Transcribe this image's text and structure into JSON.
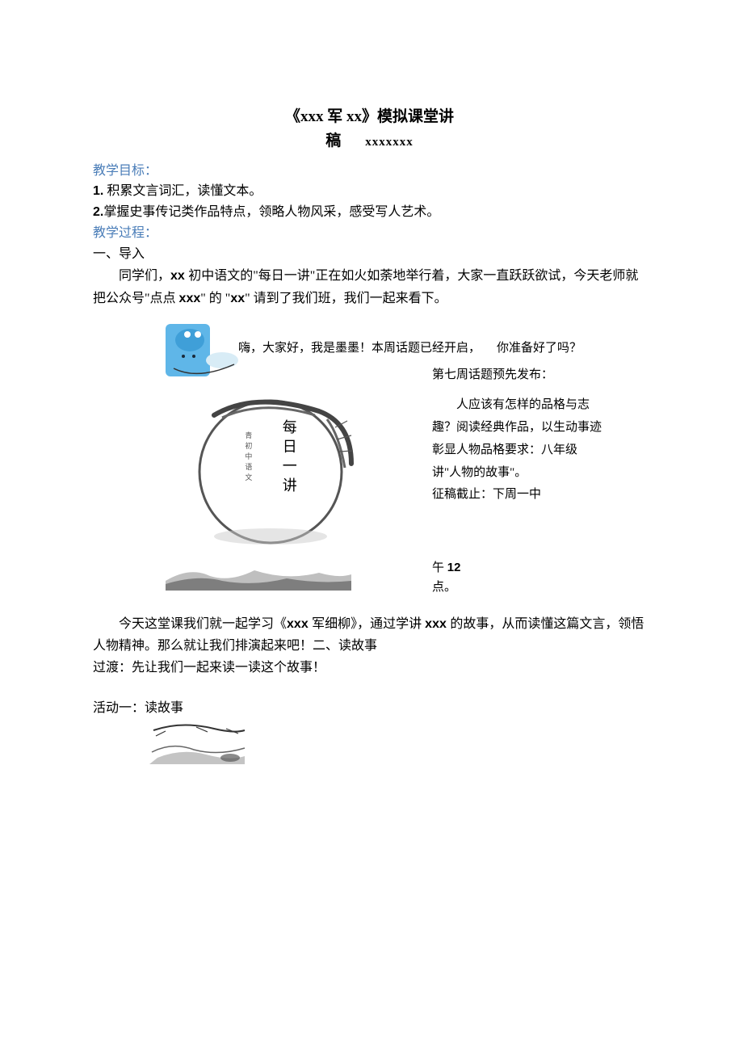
{
  "title": {
    "line1": "《xxx 军 xx》模拟课堂讲",
    "line2": "稿",
    "author": "xxxxxxx"
  },
  "objectives": {
    "label": "教学目标：",
    "item1_num": "1.",
    "item1": " 积累文言词汇，读懂文本。",
    "item2_num": "2.",
    "item2": "掌握史事传记类作品特点，领略人物风采，感受写人艺术。"
  },
  "process": {
    "label": "教学过程：",
    "section1_heading": "一、导入",
    "section1_body_a": "同学们，",
    "section1_body_b": "xx ",
    "section1_body_c": "初中语文的\"每日一讲\"正在如火如荼地举行着，大家一直跃跃欲试，今天老师就把公众号\"点点 ",
    "section1_body_d": "xxx",
    "section1_body_e": "\" 的 \"",
    "section1_body_f": "xx",
    "section1_body_g": "\" 请到了我们班，我们一起来看下。"
  },
  "figure": {
    "bubble": "嗨，大家好，我是墨墨！本周话题已经开启，",
    "ready": "你准备好了吗？",
    "vert_title": "每日一讲",
    "vert_small": "青初中语文",
    "headline": "第七周话题预先发布：",
    "topic_body": "人应该有怎样的品格与志趣？阅读经典作品，以生动事迹彰显人物品格要求：八年级讲\"人物的故事\"。",
    "deadline_label": "征稿截止：下周一中",
    "time_a": "午 ",
    "time_num": "12",
    "time_b": "点。"
  },
  "para2": {
    "a": "今天这堂课我们就一起学习《",
    "b": "xxx ",
    "c": "军细柳》，通过学讲 ",
    "d": "xxx ",
    "e": "的故事，从而读懂这篇文言，领悟人物精神。那么就让我们排演起来吧！二、读故事"
  },
  "transition": "过渡：先让我们一起来读一读这个故事！",
  "activity1": "活动一：读故事"
}
